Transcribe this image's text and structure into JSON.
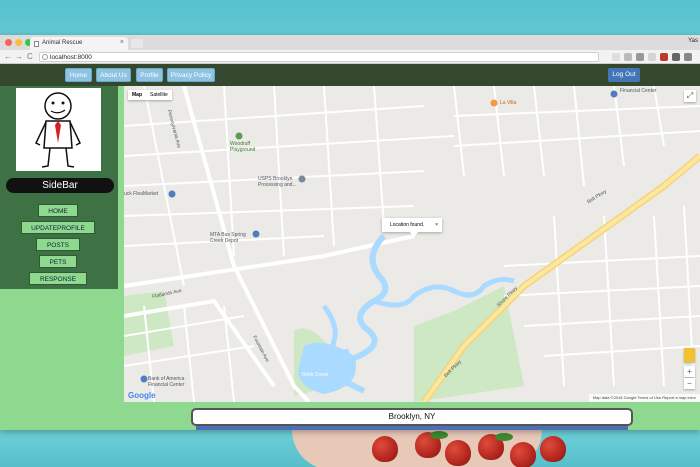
{
  "browser": {
    "tab_title": "Animal Rescue",
    "tab_close": "×",
    "url": "localhost:8000",
    "user": "Yas",
    "back": "←",
    "forward": "→",
    "reload": "C"
  },
  "navbar": {
    "links": [
      "Home",
      "About Us",
      "Profile",
      "Privacy Policy"
    ],
    "logout": "Log Out"
  },
  "sidebar": {
    "title": "SideBar",
    "items": [
      "HOME",
      "UPDATEPROFILE",
      "POSTS",
      "PETS",
      "RESPONSE"
    ]
  },
  "map": {
    "type_map": "Map",
    "type_satellite": "Satellite",
    "info_text": "Location found.",
    "info_close": "×",
    "zoom_in": "+",
    "zoom_out": "−",
    "google": "Google",
    "attribution": "Map data ©2018 Google  Terms of Use  Report a map error",
    "labels": {
      "financial_center_top": "Financial Center",
      "la_villa": "La Villa",
      "woodruff": "Woodruff Playground",
      "usps": "USPS Brooklyn Processing and...",
      "flea": "uck FleaMarket",
      "mta": "MTA Bus Spring Creek Depot",
      "betts": "Betts Creek",
      "belt_pkwy": "Belt Pkwy",
      "shore_pkwy": "Shore Pkwy",
      "bank": "Bank of America Financial Center",
      "flatlands_ave": "Flatlands Ave",
      "fountain_ave": "Fountain Ave",
      "pennsylvania_ave": "Pennsylvania Ave"
    }
  },
  "location": "Brooklyn, NY"
}
